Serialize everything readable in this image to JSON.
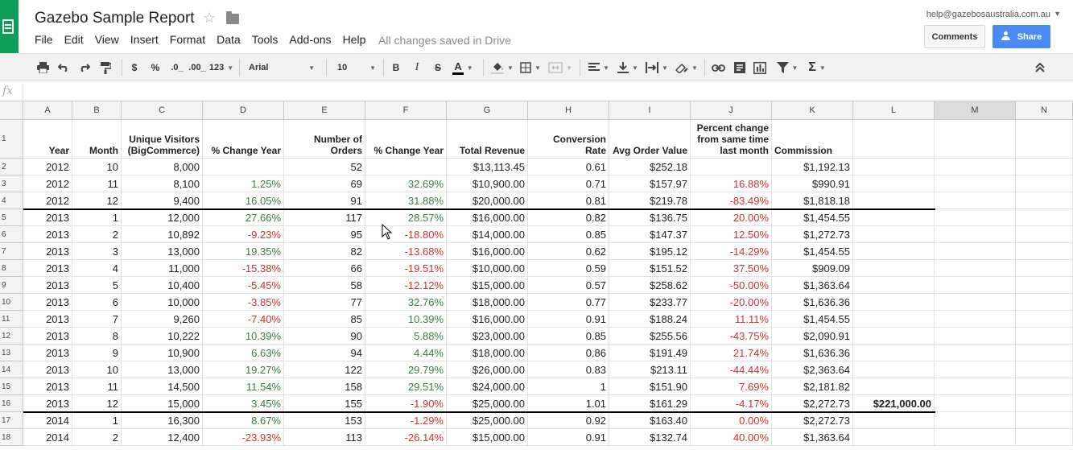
{
  "app": {
    "title": "Gazebo Sample Report",
    "save_status": "All changes saved in Drive",
    "user_email": "help@gazebosaustralia.com.au",
    "menus": [
      "File",
      "Edit",
      "View",
      "Insert",
      "Format",
      "Data",
      "Tools",
      "Add-ons",
      "Help"
    ],
    "comments_label": "Comments",
    "share_label": "Share"
  },
  "toolbar": {
    "currency_label": "$",
    "percent_label": "%",
    "dec_decrease_label": ".0_",
    "dec_increase_label": ".00_",
    "format_label": "123",
    "font": "Arial",
    "font_size": "10",
    "bold_label": "B",
    "italic_label": "I",
    "strike_label": "S",
    "text_color_label": "A",
    "function_label": "Σ"
  },
  "formula_bar": {
    "fx_label": "fx"
  },
  "colors": {
    "brand": "#0f9d58",
    "share": "#4a8af4",
    "positive": "#3d7a45",
    "negative": "#cc3333"
  },
  "sheet": {
    "columns": [
      "A",
      "B",
      "C",
      "D",
      "E",
      "F",
      "G",
      "H",
      "I",
      "J",
      "K",
      "L",
      "M",
      "N"
    ],
    "active_column": "M",
    "header_row": {
      "A": "Year",
      "B": "Month",
      "C": "Unique Visitors (BigCommerce)",
      "D": "% Change Year",
      "E": "Number of Orders",
      "F": "% Change Year",
      "G": "Total Revenue",
      "H": "Conversion Rate",
      "I": "Avg Order Value",
      "J": "Percent change from same time last month",
      "K": "Commission"
    },
    "rows": [
      {
        "n": "2",
        "A": "2012",
        "B": "10",
        "C": "8,000",
        "D": "",
        "E": "52",
        "F": "",
        "G": "$13,113.45",
        "H": "0.61",
        "I": "$252.18",
        "J": "",
        "K": "$1,192.13",
        "L": ""
      },
      {
        "n": "3",
        "A": "2012",
        "B": "11",
        "C": "8,100",
        "D": "1.25%",
        "E": "69",
        "F": "32.69%",
        "G": "$10,900.00",
        "H": "0.71",
        "I": "$157.97",
        "J": "16.88%",
        "K": "$990.91",
        "L": ""
      },
      {
        "n": "4",
        "A": "2012",
        "B": "12",
        "C": "9,400",
        "D": "16.05%",
        "E": "91",
        "F": "31.88%",
        "G": "$20,000.00",
        "H": "0.81",
        "I": "$219.78",
        "J": "-83.49%",
        "K": "$1,818.18",
        "L": ""
      },
      {
        "n": "5",
        "A": "2013",
        "B": "1",
        "C": "12,000",
        "D": "27.66%",
        "E": "117",
        "F": "28.57%",
        "G": "$16,000.00",
        "H": "0.82",
        "I": "$136.75",
        "J": "20.00%",
        "K": "$1,454.55",
        "L": ""
      },
      {
        "n": "6",
        "A": "2013",
        "B": "2",
        "C": "10,892",
        "D": "-9.23%",
        "E": "95",
        "F": "-18.80%",
        "G": "$14,000.00",
        "H": "0.85",
        "I": "$147.37",
        "J": "12.50%",
        "K": "$1,272.73",
        "L": ""
      },
      {
        "n": "7",
        "A": "2013",
        "B": "3",
        "C": "13,000",
        "D": "19.35%",
        "E": "82",
        "F": "-13.68%",
        "G": "$16,000.00",
        "H": "0.62",
        "I": "$195.12",
        "J": "-14.29%",
        "K": "$1,454.55",
        "L": ""
      },
      {
        "n": "8",
        "A": "2013",
        "B": "4",
        "C": "11,000",
        "D": "-15.38%",
        "E": "66",
        "F": "-19.51%",
        "G": "$10,000.00",
        "H": "0.59",
        "I": "$151.52",
        "J": "37.50%",
        "K": "$909.09",
        "L": ""
      },
      {
        "n": "9",
        "A": "2013",
        "B": "5",
        "C": "10,400",
        "D": "-5.45%",
        "E": "58",
        "F": "-12.12%",
        "G": "$15,000.00",
        "H": "0.57",
        "I": "$258.62",
        "J": "-50.00%",
        "K": "$1,363.64",
        "L": ""
      },
      {
        "n": "10",
        "A": "2013",
        "B": "6",
        "C": "10,000",
        "D": "-3.85%",
        "E": "77",
        "F": "32.76%",
        "G": "$18,000.00",
        "H": "0.77",
        "I": "$233.77",
        "J": "-20.00%",
        "K": "$1,636.36",
        "L": ""
      },
      {
        "n": "11",
        "A": "2013",
        "B": "7",
        "C": "9,260",
        "D": "-7.40%",
        "E": "85",
        "F": "10.39%",
        "G": "$16,000.00",
        "H": "0.91",
        "I": "$188.24",
        "J": "11.11%",
        "K": "$1,454.55",
        "L": ""
      },
      {
        "n": "12",
        "A": "2013",
        "B": "8",
        "C": "10,222",
        "D": "10.39%",
        "E": "90",
        "F": "5.88%",
        "G": "$23,000.00",
        "H": "0.85",
        "I": "$255.56",
        "J": "-43.75%",
        "K": "$2,090.91",
        "L": ""
      },
      {
        "n": "13",
        "A": "2013",
        "B": "9",
        "C": "10,900",
        "D": "6.63%",
        "E": "94",
        "F": "4.44%",
        "G": "$18,000.00",
        "H": "0.86",
        "I": "$191.49",
        "J": "21.74%",
        "K": "$1,636.36",
        "L": ""
      },
      {
        "n": "14",
        "A": "2013",
        "B": "10",
        "C": "13,000",
        "D": "19.27%",
        "E": "122",
        "F": "29.79%",
        "G": "$26,000.00",
        "H": "0.83",
        "I": "$213.11",
        "J": "-44.44%",
        "K": "$2,363.64",
        "L": ""
      },
      {
        "n": "15",
        "A": "2013",
        "B": "11",
        "C": "14,500",
        "D": "11.54%",
        "E": "158",
        "F": "29.51%",
        "G": "$24,000.00",
        "H": "1",
        "I": "$151.90",
        "J": "7.69%",
        "K": "$2,181.82",
        "L": ""
      },
      {
        "n": "16",
        "A": "2013",
        "B": "12",
        "C": "15,000",
        "D": "3.45%",
        "E": "155",
        "F": "-1.90%",
        "G": "$25,000.00",
        "H": "1.01",
        "I": "$161.29",
        "J": "-4.17%",
        "K": "$2,272.73",
        "L": "$221,000.00"
      },
      {
        "n": "17",
        "A": "2014",
        "B": "1",
        "C": "16,300",
        "D": "8.67%",
        "E": "153",
        "F": "-1.29%",
        "G": "$25,000.00",
        "H": "0.92",
        "I": "$163.40",
        "J": "0.00%",
        "K": "$2,272.73",
        "L": ""
      },
      {
        "n": "18",
        "A": "2014",
        "B": "2",
        "C": "12,400",
        "D": "-23.93%",
        "E": "113",
        "F": "-26.14%",
        "G": "$15,000.00",
        "H": "0.91",
        "I": "$132.74",
        "J": "40.00%",
        "K": "$1,363.64",
        "L": ""
      }
    ]
  }
}
